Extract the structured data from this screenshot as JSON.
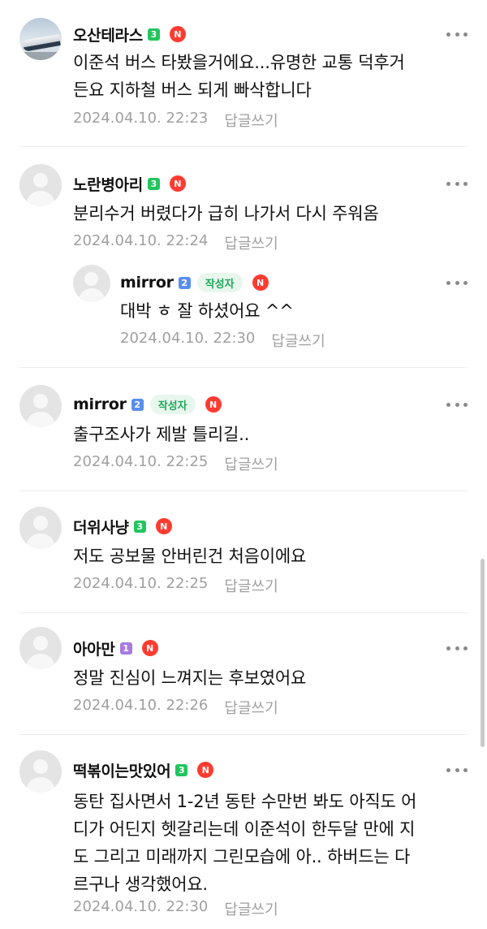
{
  "comments": [
    {
      "nick": "오산테라스",
      "level": "3",
      "badge": "N",
      "lines": [
        "이준석 버스 타봤을거에요...유명한 교통 덕후거",
        "든요 지하철 버스 되게 빠삭합니다"
      ],
      "date": "2024.04.10. 22:23",
      "reply": "답글쓰기"
    },
    {
      "nick": "노란병아리",
      "level": "3",
      "badge": "N",
      "lines": [
        "분리수거 버렸다가 급히 나가서 다시 주워옴"
      ],
      "date": "2024.04.10. 22:24",
      "reply": "답글쓰기"
    },
    {
      "nick": "mirror",
      "level": "2",
      "author": "작성자",
      "badge": "N",
      "lines": [
        "대박 ㅎ 잘 하셨어요 ^^"
      ],
      "date": "2024.04.10. 22:30",
      "reply": "답글쓰기"
    },
    {
      "nick": "mirror",
      "level": "2",
      "author": "작성자",
      "badge": "N",
      "lines": [
        "출구조사가 제발 틀리길.."
      ],
      "date": "2024.04.10. 22:25",
      "reply": "답글쓰기"
    },
    {
      "nick": "더위사냥",
      "level": "3",
      "badge": "N",
      "lines": [
        "저도 공보물 안버린건 처음이에요"
      ],
      "date": "2024.04.10. 22:25",
      "reply": "답글쓰기"
    },
    {
      "nick": "아아만",
      "level": "1",
      "badge": "N",
      "lines": [
        "정말 진심이 느껴지는 후보였어요"
      ],
      "date": "2024.04.10. 22:26",
      "reply": "답글쓰기"
    },
    {
      "nick": "떡볶이는맛있어",
      "level": "3",
      "badge": "N",
      "lines": [
        "동탄 집사면서 1-2년 동탄 수만번 봐도 아직도 어",
        "디가 어딘지 헷갈리는데 이준석이 한두달 만에 지",
        "도 그리고 미래까지 그린모습에 아.. 하버드는 다",
        "르구나 생각했어요."
      ],
      "date": "2024.04.10. 22:30",
      "reply": "답글쓰기"
    }
  ],
  "colors": {
    "level3": "#22c55e",
    "level2": "#5b8def",
    "level1": "#a77be0",
    "new": "#ff3b30",
    "author_bg": "#e8f7ee",
    "author_fg": "#1fa85a"
  },
  "icons": {
    "more": "more-vertical-dots-icon",
    "avatar": "default-avatar-icon"
  }
}
